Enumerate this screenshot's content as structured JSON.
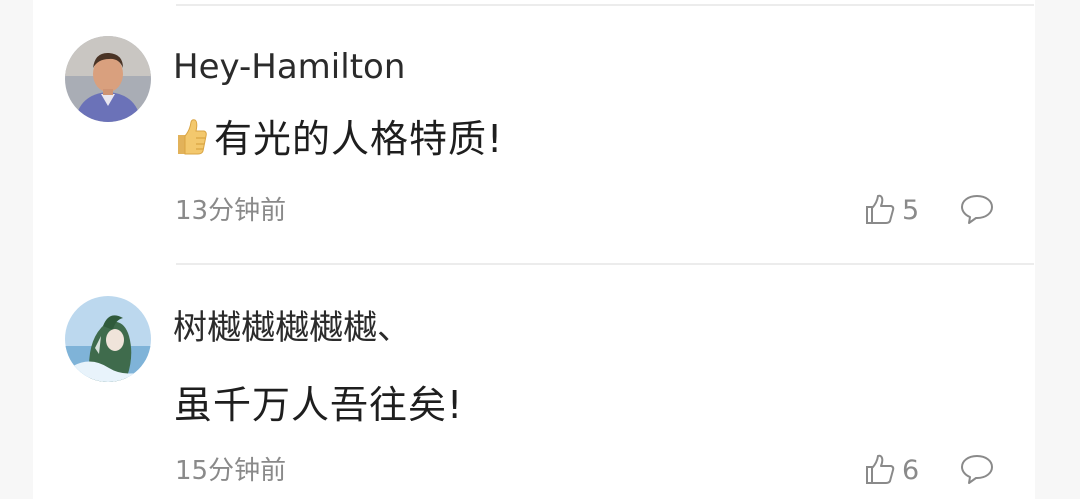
{
  "comments": [
    {
      "name": "Hey-Hamilton",
      "emoji": "thumbs-up-emoji",
      "text": "有光的人格特质!",
      "time": "13分钟前",
      "likes": "5",
      "avatar": "photo-avatar"
    },
    {
      "name": "树樾樾樾樾樾、",
      "text": "虽千万人吾往矣!",
      "time": "15分钟前",
      "likes": "6",
      "avatar": "anime-avatar"
    }
  ],
  "icons": {
    "like": "thumbs-up-outline-icon",
    "reply": "speech-bubble-icon"
  },
  "colors": {
    "meta": "#8a8a8a",
    "text": "#1e1e1e",
    "separator": "#ececec"
  }
}
